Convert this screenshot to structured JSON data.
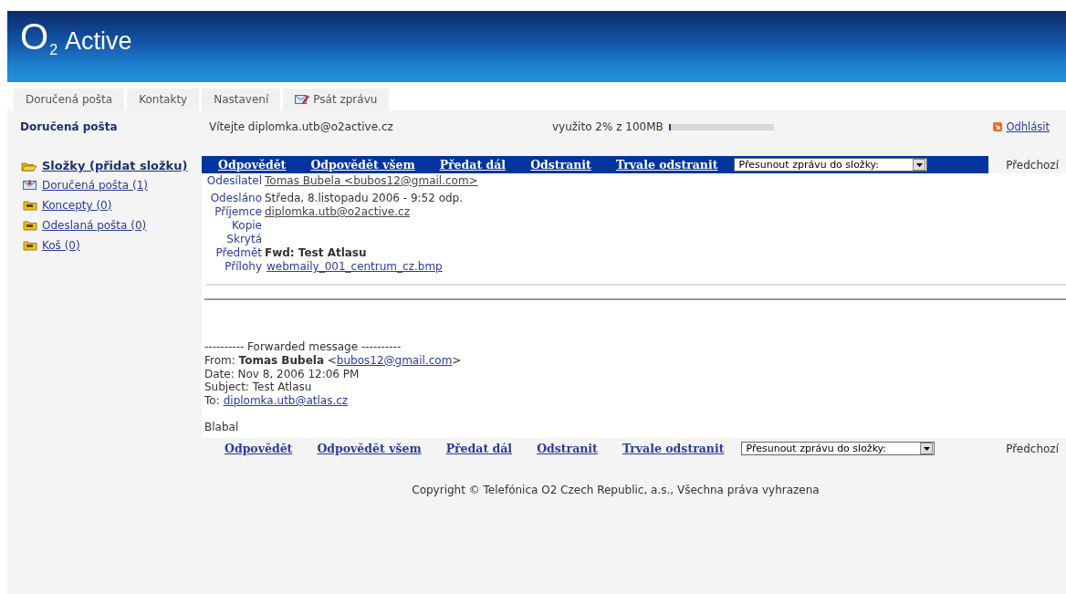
{
  "logo": {
    "mark": "O",
    "sub": "2",
    "name": "Active"
  },
  "tabs": [
    {
      "label": "Doručená pošta",
      "kind": "plain"
    },
    {
      "label": "Kontakty",
      "kind": "plain"
    },
    {
      "label": "Nastavení",
      "kind": "plain"
    },
    {
      "label": "Psát zprávu",
      "kind": "compose"
    }
  ],
  "info_bar": {
    "folder_title": "Doručená pošta",
    "welcome": "Vítejte diplomka.utb@o2active.cz",
    "usage": "využito 2% z 100MB",
    "level": 0.02,
    "logout": "Odhlásit"
  },
  "sidebar": {
    "header": "Složky (přidat složku)",
    "items": [
      {
        "label": "Doručená pošta (1)",
        "kind": "inbox"
      },
      {
        "label": "Koncepty (0)",
        "kind": "folder"
      },
      {
        "label": "Odeslaná pošta (0)",
        "kind": "folder"
      },
      {
        "label": "Koš (0)",
        "kind": "folder"
      }
    ]
  },
  "toolbar_top": {
    "actions": [
      "Odpovědět",
      "Odpovědět všem",
      "Předat dál",
      "Odstranit",
      "Trvale odstranit"
    ],
    "move_select": "Přesunout zprávu do složky:",
    "previous": "Předchozí"
  },
  "headers": [
    {
      "label": "Odesílatel",
      "value": "Tomas Bubela <bubos12@gmail.com>",
      "kind": "link"
    },
    {
      "label": "Odesláno",
      "value": "Středa, 8.listopadu 2006 - 9:52 odp.",
      "kind": "text"
    },
    {
      "label": "Příjemce",
      "value": "diplomka.utb@o2active.cz",
      "kind": "link"
    },
    {
      "label": "Kopie",
      "kind": "text"
    },
    {
      "label": "Skrytá",
      "kind": "text"
    },
    {
      "label": "Předmět",
      "value": "Fwd: Test Atlasu",
      "kind": "bold"
    },
    {
      "label": "Přílohy",
      "value": "webmaily_001_centrum_cz.bmp",
      "kind": "attachment"
    }
  ],
  "body": {
    "forward_line": "---------- Forwarded message ----------",
    "from_label": "From:",
    "from_name": "Tomas Bubela",
    "from_email": "bubos12@gmail.com",
    "from_open": "<",
    "from_close": ">",
    "date": "Date: Nov 8, 2006 12:06 PM",
    "subject": "Subject: Test Atlasu",
    "to_label": "To:",
    "to_email": "diplomka.utb@atlas.cz",
    "text": "Blabal"
  },
  "toolbar_bottom": {
    "actions": [
      "Odpovědět",
      "Odpovědět všem",
      "Předat dál",
      "Odstranit",
      "Trvale odstranit"
    ],
    "move_select": "Přesunout zprávu do složky:",
    "previous": "Předchozí"
  },
  "footer": "Copyright © Telefónica O2 Czech Republic, a.s., Všechna práva vyhrazena"
}
